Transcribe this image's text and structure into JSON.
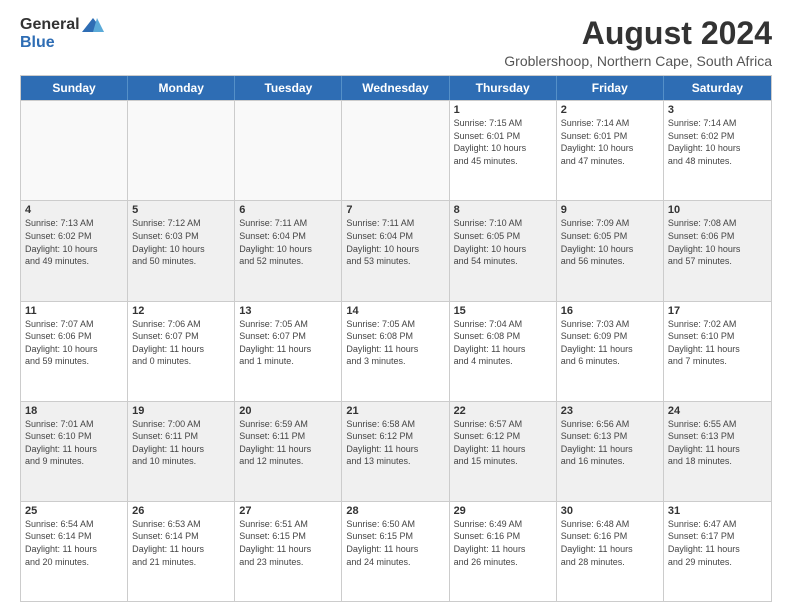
{
  "logo": {
    "general": "General",
    "blue": "Blue"
  },
  "title": "August 2024",
  "subtitle": "Groblershoop, Northern Cape, South Africa",
  "days": [
    "Sunday",
    "Monday",
    "Tuesday",
    "Wednesday",
    "Thursday",
    "Friday",
    "Saturday"
  ],
  "rows": [
    [
      {
        "num": "",
        "info": "",
        "empty": true
      },
      {
        "num": "",
        "info": "",
        "empty": true
      },
      {
        "num": "",
        "info": "",
        "empty": true
      },
      {
        "num": "",
        "info": "",
        "empty": true
      },
      {
        "num": "1",
        "info": "Sunrise: 7:15 AM\nSunset: 6:01 PM\nDaylight: 10 hours\nand 45 minutes."
      },
      {
        "num": "2",
        "info": "Sunrise: 7:14 AM\nSunset: 6:01 PM\nDaylight: 10 hours\nand 47 minutes."
      },
      {
        "num": "3",
        "info": "Sunrise: 7:14 AM\nSunset: 6:02 PM\nDaylight: 10 hours\nand 48 minutes."
      }
    ],
    [
      {
        "num": "4",
        "info": "Sunrise: 7:13 AM\nSunset: 6:02 PM\nDaylight: 10 hours\nand 49 minutes.",
        "shaded": true
      },
      {
        "num": "5",
        "info": "Sunrise: 7:12 AM\nSunset: 6:03 PM\nDaylight: 10 hours\nand 50 minutes.",
        "shaded": true
      },
      {
        "num": "6",
        "info": "Sunrise: 7:11 AM\nSunset: 6:04 PM\nDaylight: 10 hours\nand 52 minutes.",
        "shaded": true
      },
      {
        "num": "7",
        "info": "Sunrise: 7:11 AM\nSunset: 6:04 PM\nDaylight: 10 hours\nand 53 minutes.",
        "shaded": true
      },
      {
        "num": "8",
        "info": "Sunrise: 7:10 AM\nSunset: 6:05 PM\nDaylight: 10 hours\nand 54 minutes.",
        "shaded": true
      },
      {
        "num": "9",
        "info": "Sunrise: 7:09 AM\nSunset: 6:05 PM\nDaylight: 10 hours\nand 56 minutes.",
        "shaded": true
      },
      {
        "num": "10",
        "info": "Sunrise: 7:08 AM\nSunset: 6:06 PM\nDaylight: 10 hours\nand 57 minutes.",
        "shaded": true
      }
    ],
    [
      {
        "num": "11",
        "info": "Sunrise: 7:07 AM\nSunset: 6:06 PM\nDaylight: 10 hours\nand 59 minutes."
      },
      {
        "num": "12",
        "info": "Sunrise: 7:06 AM\nSunset: 6:07 PM\nDaylight: 11 hours\nand 0 minutes."
      },
      {
        "num": "13",
        "info": "Sunrise: 7:05 AM\nSunset: 6:07 PM\nDaylight: 11 hours\nand 1 minute."
      },
      {
        "num": "14",
        "info": "Sunrise: 7:05 AM\nSunset: 6:08 PM\nDaylight: 11 hours\nand 3 minutes."
      },
      {
        "num": "15",
        "info": "Sunrise: 7:04 AM\nSunset: 6:08 PM\nDaylight: 11 hours\nand 4 minutes."
      },
      {
        "num": "16",
        "info": "Sunrise: 7:03 AM\nSunset: 6:09 PM\nDaylight: 11 hours\nand 6 minutes."
      },
      {
        "num": "17",
        "info": "Sunrise: 7:02 AM\nSunset: 6:10 PM\nDaylight: 11 hours\nand 7 minutes."
      }
    ],
    [
      {
        "num": "18",
        "info": "Sunrise: 7:01 AM\nSunset: 6:10 PM\nDaylight: 11 hours\nand 9 minutes.",
        "shaded": true
      },
      {
        "num": "19",
        "info": "Sunrise: 7:00 AM\nSunset: 6:11 PM\nDaylight: 11 hours\nand 10 minutes.",
        "shaded": true
      },
      {
        "num": "20",
        "info": "Sunrise: 6:59 AM\nSunset: 6:11 PM\nDaylight: 11 hours\nand 12 minutes.",
        "shaded": true
      },
      {
        "num": "21",
        "info": "Sunrise: 6:58 AM\nSunset: 6:12 PM\nDaylight: 11 hours\nand 13 minutes.",
        "shaded": true
      },
      {
        "num": "22",
        "info": "Sunrise: 6:57 AM\nSunset: 6:12 PM\nDaylight: 11 hours\nand 15 minutes.",
        "shaded": true
      },
      {
        "num": "23",
        "info": "Sunrise: 6:56 AM\nSunset: 6:13 PM\nDaylight: 11 hours\nand 16 minutes.",
        "shaded": true
      },
      {
        "num": "24",
        "info": "Sunrise: 6:55 AM\nSunset: 6:13 PM\nDaylight: 11 hours\nand 18 minutes.",
        "shaded": true
      }
    ],
    [
      {
        "num": "25",
        "info": "Sunrise: 6:54 AM\nSunset: 6:14 PM\nDaylight: 11 hours\nand 20 minutes."
      },
      {
        "num": "26",
        "info": "Sunrise: 6:53 AM\nSunset: 6:14 PM\nDaylight: 11 hours\nand 21 minutes."
      },
      {
        "num": "27",
        "info": "Sunrise: 6:51 AM\nSunset: 6:15 PM\nDaylight: 11 hours\nand 23 minutes."
      },
      {
        "num": "28",
        "info": "Sunrise: 6:50 AM\nSunset: 6:15 PM\nDaylight: 11 hours\nand 24 minutes."
      },
      {
        "num": "29",
        "info": "Sunrise: 6:49 AM\nSunset: 6:16 PM\nDaylight: 11 hours\nand 26 minutes."
      },
      {
        "num": "30",
        "info": "Sunrise: 6:48 AM\nSunset: 6:16 PM\nDaylight: 11 hours\nand 28 minutes."
      },
      {
        "num": "31",
        "info": "Sunrise: 6:47 AM\nSunset: 6:17 PM\nDaylight: 11 hours\nand 29 minutes."
      }
    ]
  ]
}
